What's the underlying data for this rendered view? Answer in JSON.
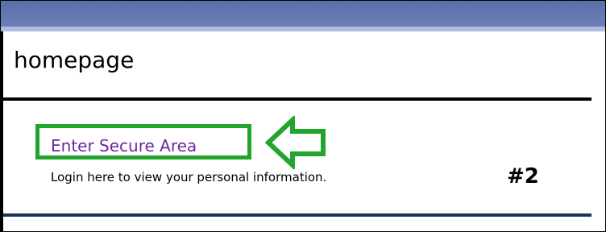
{
  "page": {
    "title": "homepage"
  },
  "secure_area": {
    "link_label": "Enter Secure Area",
    "description": "Login here to view your personal information."
  },
  "annotation": {
    "step_label": "#2",
    "highlight_color": "#22a52f"
  },
  "colors": {
    "header_band": "#5a6fa8",
    "header_strip": "#aebce0",
    "link": "#6f27a0",
    "bottom_rule": "#16365c"
  }
}
